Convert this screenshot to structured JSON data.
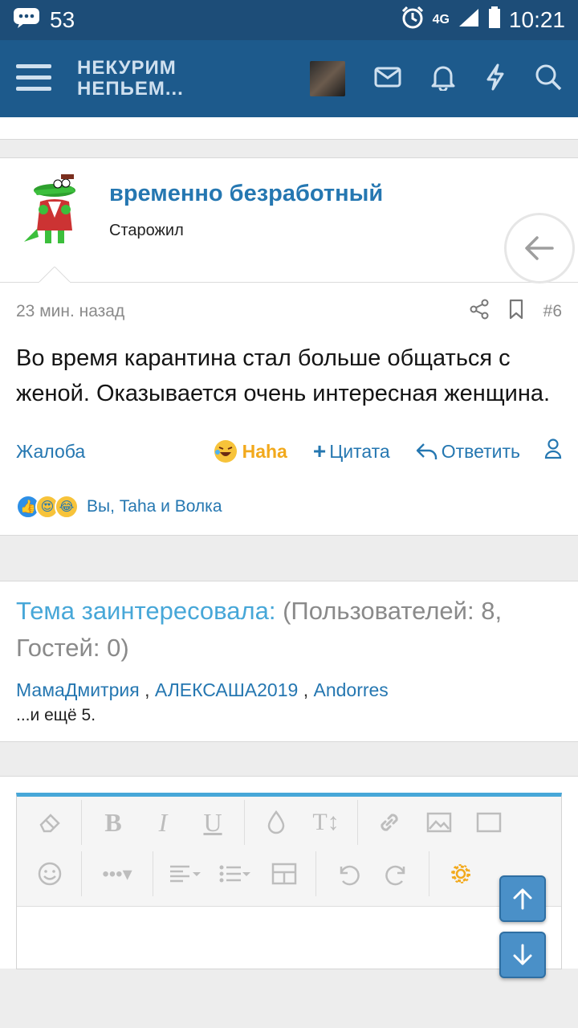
{
  "statusbar": {
    "notif_count": "53",
    "network": "4G",
    "time": "10:21"
  },
  "appbar": {
    "logo_line1": "НЕКУРИМ",
    "logo_line2": "НЕПЬЕМ..."
  },
  "post": {
    "username": "временно безработный",
    "user_title": "Старожил",
    "time_ago": "23 мин. назад",
    "post_number": "#6",
    "body": "Во время карантина стал больше общаться с женой. Оказывается очень интересная женщина.",
    "actions": {
      "report": "Жалоба",
      "reaction": "Haha",
      "quote": "Цитата",
      "reply": "Ответить"
    },
    "reactions_text": "Вы, Taha и Волка"
  },
  "viewers": {
    "title_a": "Тема заинтересовала:",
    "title_b": "(Пользователей: 8, Гостей: 0)",
    "users": [
      "МамаДмитрия",
      "АЛЕКСАША2019",
      "Andorres"
    ],
    "separator": ",",
    "more": "...и ещё 5."
  },
  "colors": {
    "header": "#1d5a8c",
    "statusbar": "#1d4d78",
    "link": "#2577b1",
    "accent": "#47a7d8",
    "haha": "#f2a91c"
  }
}
